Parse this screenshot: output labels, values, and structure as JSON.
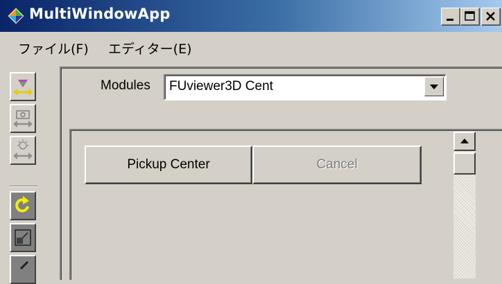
{
  "window": {
    "title": "MultiWindowApp",
    "icon": "app-diamond-icon"
  },
  "menu": {
    "items": [
      "ファイル(F)",
      "エディター(E)"
    ]
  },
  "toolbar": {
    "icons": [
      "pyramid-arrows-icon",
      "camera-arrows-icon",
      "lightbulb-arrows-icon",
      "rotate-yellow-icon",
      "resize-square-icon"
    ]
  },
  "modules": {
    "label": "Modules",
    "selected": "FUviewer3D Cent"
  },
  "buttons": {
    "pickup": "Pickup Center",
    "cancel": "Cancel"
  }
}
